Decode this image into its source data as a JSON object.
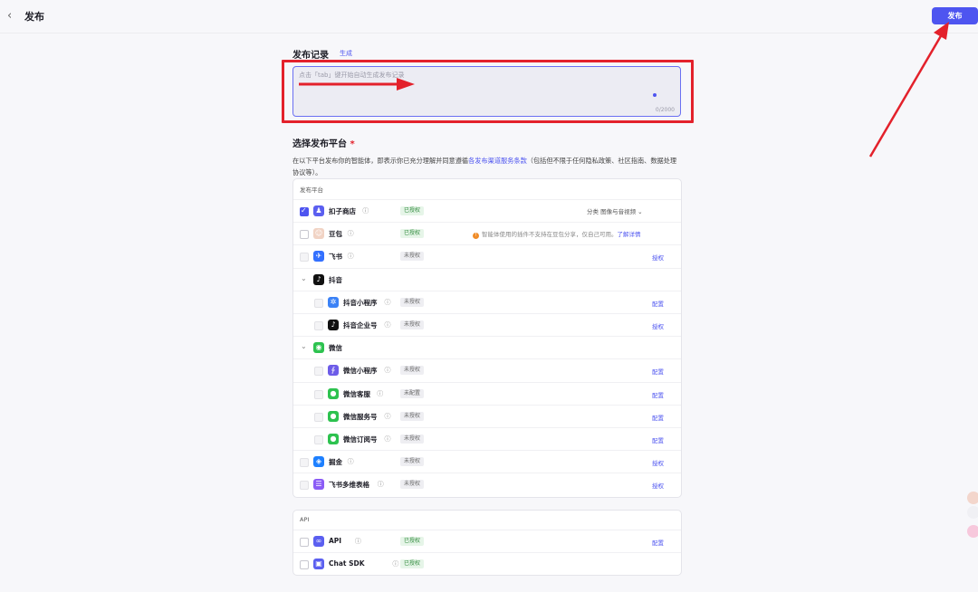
{
  "header": {
    "back_icon": "‹",
    "title": "发布",
    "publish_button": "发布"
  },
  "record": {
    "label": "发布记录",
    "generate": "生成",
    "placeholder": "点击「tab」键开始自动生成发布记录",
    "counter": "0/2000"
  },
  "platform": {
    "label": "选择发布平台",
    "required": "*",
    "desc_before": "在以下平台发布你的智能体，即表示你已充分理解并同意遵循",
    "desc_link": "各发布渠道服务条款",
    "desc_after": "（包括但不限于任何隐私政策、社区指南、数据处理协议等）。",
    "card_title": "发布平台",
    "category_label": "分类",
    "category_value": "图像与音视频",
    "warn_text": "智能体使用的插件不支持在豆包分享，仅自己可用。",
    "warn_link": "了解详情",
    "items": [
      {
        "name": "扣子商店",
        "badge": "已授权",
        "badge_kind": "ok",
        "action": "",
        "icon": "store-icon",
        "icon_color": "#5b5ff0",
        "glyph": "♟"
      },
      {
        "name": "豆包",
        "badge": "已授权",
        "badge_kind": "ok",
        "action": "",
        "icon": "doubao-icon",
        "icon_color": "#f1d3c4",
        "glyph": "☺"
      },
      {
        "name": "飞书",
        "badge": "未授权",
        "badge_kind": "no",
        "action": "授权",
        "icon": "feishu-icon",
        "icon_color": "#3370ff",
        "glyph": "✈"
      },
      {
        "name": "抖音",
        "badge": "",
        "badge_kind": "",
        "action": "",
        "icon": "douyin-icon",
        "icon_color": "#111111",
        "glyph": "♪"
      },
      {
        "name": "抖音小程序",
        "badge": "未授权",
        "badge_kind": "no",
        "action": "配置",
        "icon": "douyin-miniapp-icon",
        "icon_color": "#3b82f6",
        "glyph": "✲"
      },
      {
        "name": "抖音企业号",
        "badge": "未授权",
        "badge_kind": "no",
        "action": "授权",
        "icon": "douyin-enterprise-icon",
        "icon_color": "#111111",
        "glyph": "♪"
      },
      {
        "name": "微信",
        "badge": "",
        "badge_kind": "",
        "action": "",
        "icon": "wechat-icon",
        "icon_color": "#2dc24f",
        "glyph": "◉"
      },
      {
        "name": "微信小程序",
        "badge": "未授权",
        "badge_kind": "no",
        "action": "配置",
        "icon": "wechat-miniapp-icon",
        "icon_color": "#6d5ce8",
        "glyph": "∮"
      },
      {
        "name": "微信客服",
        "badge": "未配置",
        "badge_kind": "no",
        "action": "配置",
        "icon": "wechat-service-icon",
        "icon_color": "#2dc24f",
        "glyph": "●"
      },
      {
        "name": "微信服务号",
        "badge": "未授权",
        "badge_kind": "no",
        "action": "配置",
        "icon": "wechat-official-icon",
        "icon_color": "#2dc24f",
        "glyph": "●"
      },
      {
        "name": "微信订阅号",
        "badge": "未授权",
        "badge_kind": "no",
        "action": "配置",
        "icon": "wechat-subscription-icon",
        "icon_color": "#2dc24f",
        "glyph": "●"
      },
      {
        "name": "掘金",
        "badge": "未授权",
        "badge_kind": "no",
        "action": "授权",
        "icon": "juejin-icon",
        "icon_color": "#1e80ff",
        "glyph": "◈"
      },
      {
        "name": "飞书多维表格",
        "badge": "未授权",
        "badge_kind": "no",
        "action": "授权",
        "icon": "feishu-bitable-icon",
        "icon_color": "#8b5cf6",
        "glyph": "☰"
      }
    ]
  },
  "api": {
    "card_title": "API",
    "items": [
      {
        "name": "API",
        "badge": "已授权",
        "badge_kind": "ok",
        "action": "配置",
        "icon": "api-link-icon",
        "icon_color": "#5b5ff0",
        "glyph": "∞"
      },
      {
        "name": "Chat SDK",
        "badge": "已授权",
        "badge_kind": "ok",
        "action": "",
        "icon": "chat-sdk-icon",
        "icon_color": "#5b5ff0",
        "glyph": "▣"
      }
    ]
  },
  "colors": {
    "accent": "#4e55f0",
    "highlight": "#e3212b"
  }
}
